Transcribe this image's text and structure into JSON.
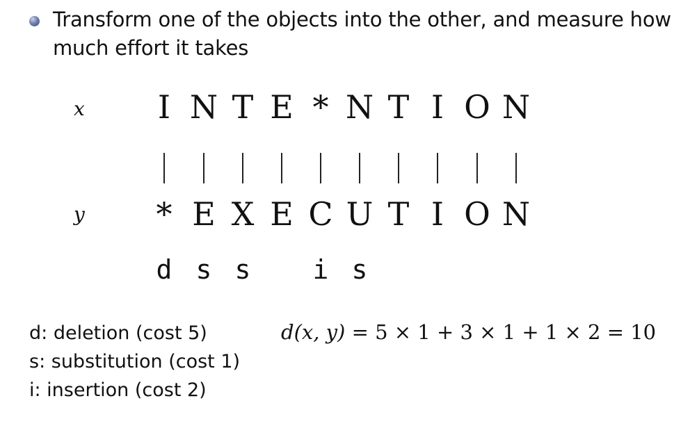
{
  "bullet": {
    "icon": "bullet-dot-icon",
    "text": "Transform one of the objects into the other, and measure how much effort it takes"
  },
  "labels": {
    "x": "x",
    "y": "y"
  },
  "alignment": {
    "x_row": [
      "I",
      "N",
      "T",
      "E",
      "*",
      "N",
      "T",
      "I",
      "O",
      "N"
    ],
    "separators": [
      "|",
      "|",
      "|",
      "|",
      "|",
      "|",
      "|",
      "|",
      "|",
      "|"
    ],
    "y_row": [
      "*",
      "E",
      "X",
      "E",
      "C",
      "U",
      "T",
      "I",
      "O",
      "N"
    ],
    "operations": [
      "d",
      "s",
      "s",
      "",
      "i",
      "s",
      "",
      "",
      "",
      ""
    ]
  },
  "legend": [
    "d: deletion (cost 5)",
    "s: substitution (cost 1)",
    "i: insertion (cost 2)"
  ],
  "formula": {
    "lhs": "d(x, y)",
    "rhs": "= 5 × 1 + 3 × 1 + 1 × 2 = 10"
  }
}
